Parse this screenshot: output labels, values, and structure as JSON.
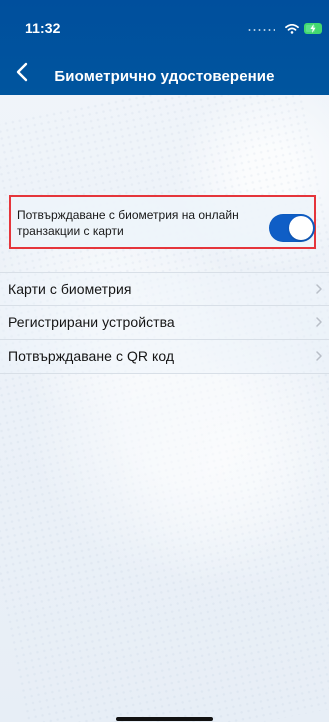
{
  "status_bar": {
    "time": "11:32",
    "icons": [
      "signal-dots-icon",
      "wifi-icon",
      "battery-charging-icon"
    ]
  },
  "navigation": {
    "back_icon": "chevron-left-icon",
    "title": "Биометрично удостоверение"
  },
  "biometric_setting": {
    "label": "Потвърждаване с биометрия на онлайн транзакции с карти",
    "enabled": true,
    "toggle_color": "#0f5ec6",
    "highlight_border_color": "#e5353b"
  },
  "menu": [
    {
      "label": "Карти с биометрия",
      "icon": "chevron-right-icon"
    },
    {
      "label": "Регистрирани устройства",
      "icon": "chevron-right-icon"
    },
    {
      "label": "Потвърждаване с QR код",
      "icon": "chevron-right-icon"
    }
  ],
  "colors": {
    "header_blue": "#0055a0",
    "background": "#e9eff6",
    "text": "#151515",
    "chevron": "#b8bec7"
  }
}
